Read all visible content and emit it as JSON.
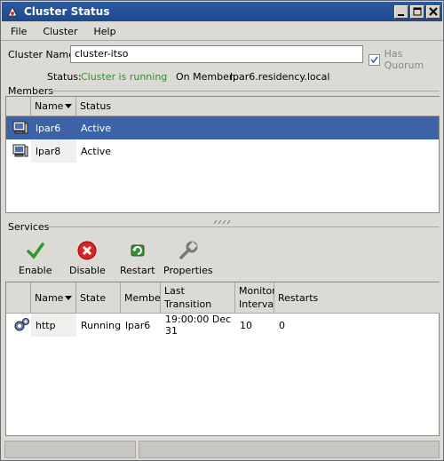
{
  "window": {
    "title": "Cluster Status",
    "minimize_icon": "minimize-icon",
    "maximize_icon": "maximize-icon",
    "close_icon": "close-icon"
  },
  "menu": {
    "file": "File",
    "cluster": "Cluster",
    "help": "Help"
  },
  "cluster": {
    "name_label": "Cluster Name:",
    "name_value": "cluster-itso",
    "has_quorum_label": "Has Quorum",
    "has_quorum_checked": true,
    "status_label": "Status:",
    "status_value": "Cluster is running",
    "on_member_label": "On Member:",
    "on_member_value": "lpar6.residency.local",
    "status_color": "#2f8f2f"
  },
  "members": {
    "section_label": "Members",
    "columns": [
      "Name",
      "Status"
    ],
    "rows": [
      {
        "name": "lpar6",
        "status": "Active",
        "selected": true
      },
      {
        "name": "lpar8",
        "status": "Active",
        "selected": false
      }
    ]
  },
  "services": {
    "section_label": "Services",
    "toolbar": [
      {
        "label": "Enable",
        "icon": "check-icon"
      },
      {
        "label": "Disable",
        "icon": "stop-icon"
      },
      {
        "label": "Restart",
        "icon": "restart-icon"
      },
      {
        "label": "Properties",
        "icon": "wrench-icon"
      }
    ],
    "columns": [
      "Name",
      "State",
      "Member",
      "Last Transition",
      "Monitor Interval",
      "Restarts"
    ],
    "rows": [
      {
        "name": "http",
        "state": "Running",
        "member": "lpar6",
        "last_transition": "19:00:00 Dec 31",
        "monitor_interval": "10",
        "restarts": "0"
      }
    ]
  },
  "colors": {
    "title_bar": "#1e4a8c",
    "selection": "#3c63a7",
    "window_bg": "#dcdad5"
  }
}
